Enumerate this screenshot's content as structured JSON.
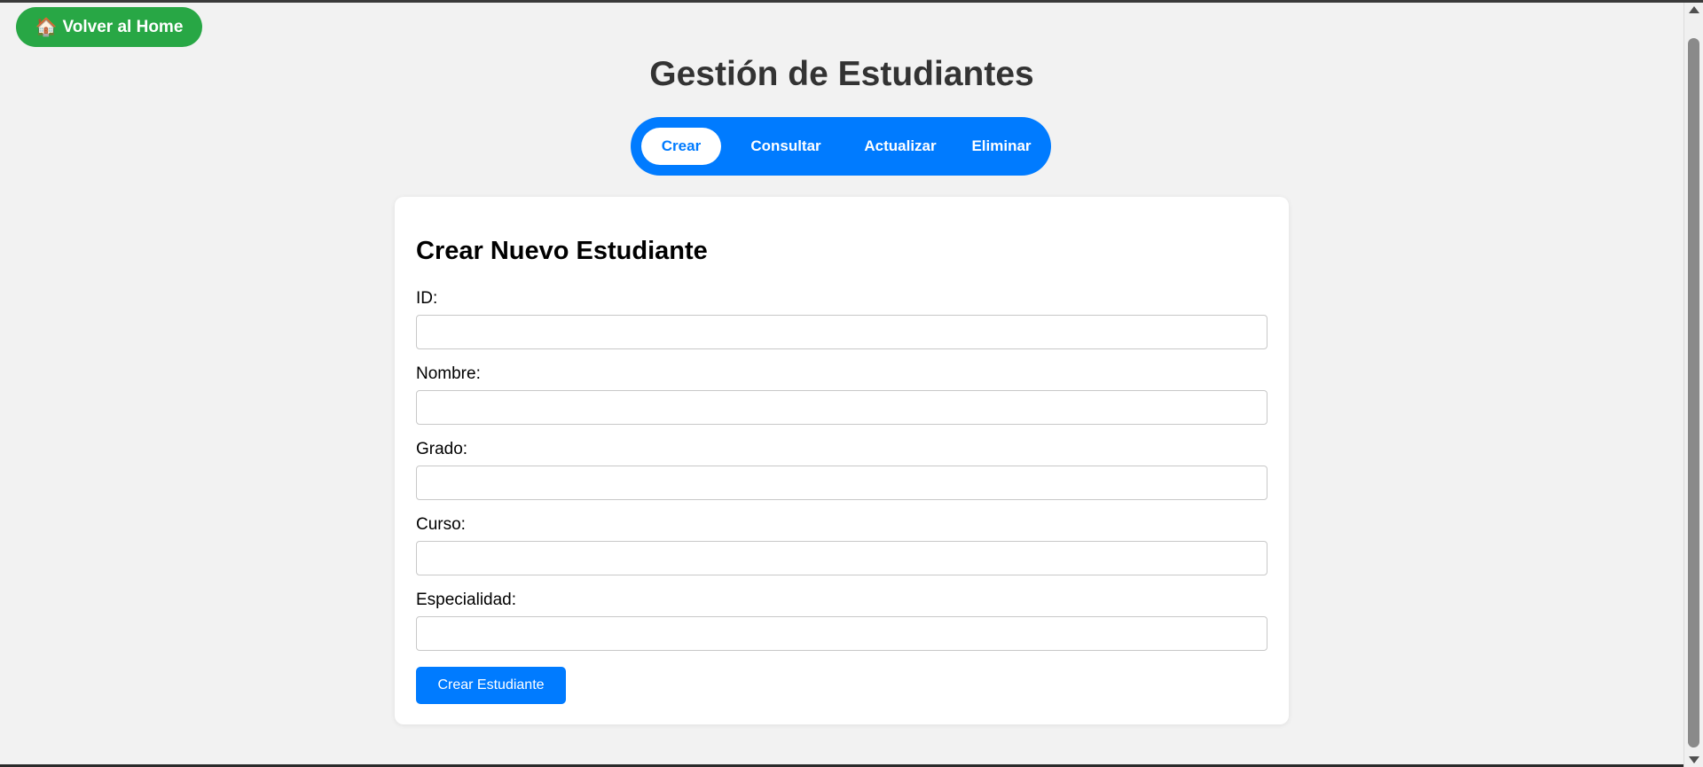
{
  "home_button": {
    "icon": "house-icon",
    "glyph": "🏠",
    "label": "Volver al Home"
  },
  "page": {
    "title": "Gestión de Estudiantes"
  },
  "tabs": [
    {
      "label": "Crear",
      "active": true
    },
    {
      "label": "Consultar",
      "active": false
    },
    {
      "label": "Actualizar",
      "active": false
    },
    {
      "label": "Eliminar",
      "active": false
    }
  ],
  "form": {
    "title": "Crear Nuevo Estudiante",
    "fields": [
      {
        "label": "ID:",
        "value": ""
      },
      {
        "label": "Nombre:",
        "value": ""
      },
      {
        "label": "Grado:",
        "value": ""
      },
      {
        "label": "Curso:",
        "value": ""
      },
      {
        "label": "Especialidad:",
        "value": ""
      }
    ],
    "submit_label": "Crear Estudiante"
  },
  "colors": {
    "home_green": "#28a745",
    "primary_blue": "#007bff",
    "background": "#f2f2f2",
    "title_text": "#333333"
  }
}
